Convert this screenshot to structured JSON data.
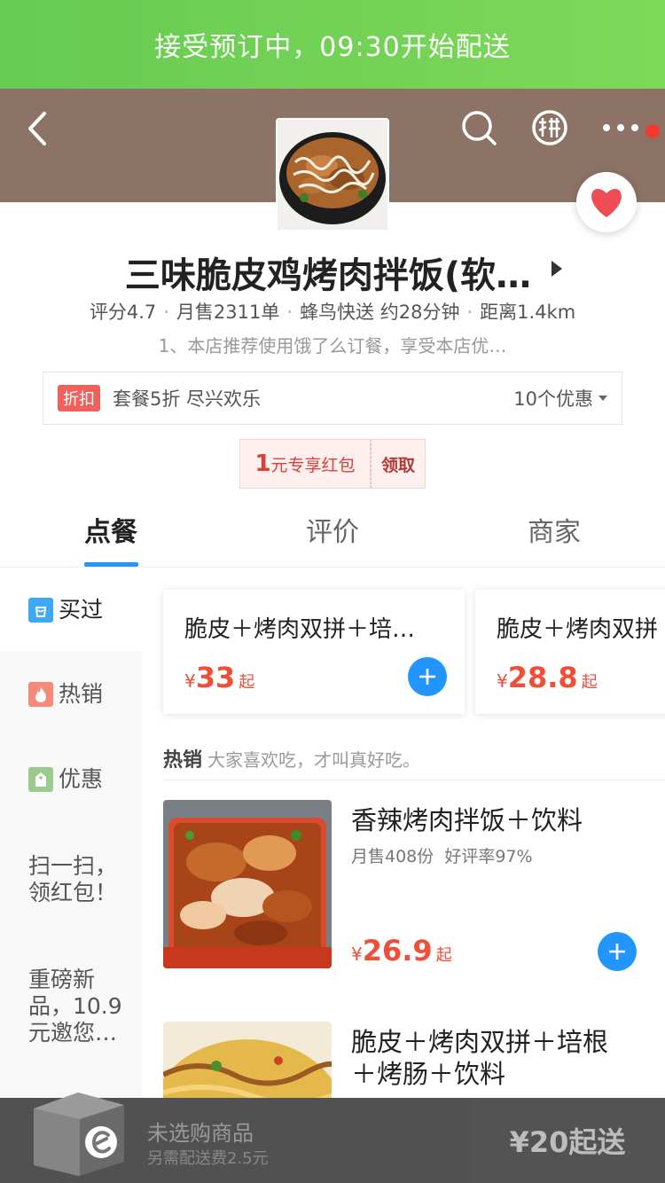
{
  "top_notice": "接受预订中，09:30开始配送",
  "shop": {
    "name": "三味脆皮鸡烤肉拌饭(软…",
    "stats": {
      "rating": "评分4.7",
      "monthly_sales": "月售2311单",
      "delivery": "蜂鸟快送 约28分钟",
      "distance": "距离1.4km"
    },
    "notice": "1、本店推荐使用饿了么订餐，享受本店优…"
  },
  "promo": {
    "tag": "折扣",
    "text": "套餐5折 尽兴欢乐",
    "count": "10个优惠"
  },
  "coupon": {
    "amount": "1",
    "label": "元专享红包",
    "claim": "领取"
  },
  "tabs": [
    {
      "label": "点餐"
    },
    {
      "label": "评价"
    },
    {
      "label": "商家"
    }
  ],
  "sidebar": {
    "items": [
      {
        "label": "买过",
        "icon": "shopping-bag-icon"
      },
      {
        "label": "热销",
        "icon": "flame-icon"
      },
      {
        "label": "优惠",
        "icon": "discount-tag-icon"
      },
      {
        "label": "扫一扫，\n领红包！"
      },
      {
        "label": "重磅新\n品，10.9\n元邀您…"
      }
    ]
  },
  "recommended": [
    {
      "name": "脆皮＋烤肉双拼＋培…",
      "currency": "¥",
      "price": "33",
      "suffix": "起"
    },
    {
      "name": "脆皮＋烤肉双拼",
      "currency": "¥",
      "price": "28.8",
      "suffix": "起"
    }
  ],
  "section": {
    "title": "热销",
    "desc": "大家喜欢吃，才叫真好吃。"
  },
  "foods": [
    {
      "name": "香辣烤肉拌饭＋饮料",
      "sales": "月售408份",
      "rating": "好评率97%",
      "currency": "¥",
      "price": "26.9",
      "suffix": "起"
    },
    {
      "name": "脆皮＋烤肉双拼＋培根＋烤肠＋饮料"
    }
  ],
  "cart": {
    "title": "未选购商品",
    "subtitle": "另需配送费2.5元",
    "submit": "¥20起送"
  },
  "colors": {
    "accent_blue": "#2395ff",
    "price_red": "#f04e37",
    "notice_green": "#66cc52",
    "header_brown": "#8d7266"
  }
}
